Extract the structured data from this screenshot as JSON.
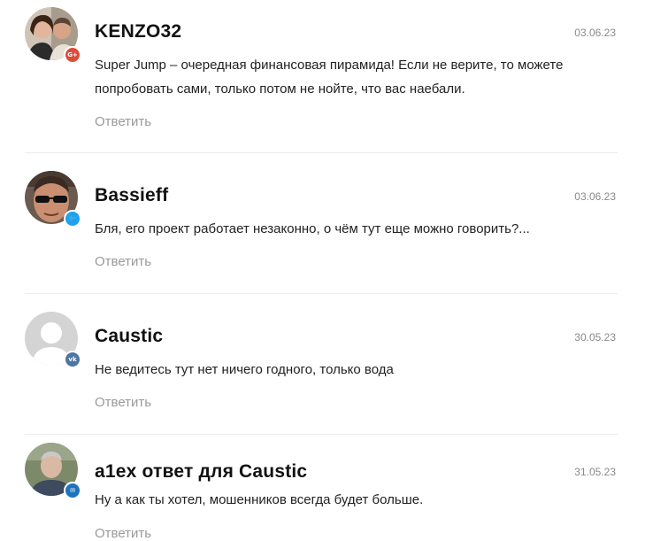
{
  "comments": [
    {
      "author": "KENZO32",
      "date": "03.06.23",
      "text": "Super Jump – очередная финансовая пирамида! Если не верите, то можете попробовать сами, только потом не нойте, что вас наебали.",
      "reply_label": "Ответить",
      "social": "google-plus",
      "badge_label": "G+",
      "badge_color": "#dd4b39"
    },
    {
      "author": "Bassieff",
      "date": "03.06.23",
      "text": "Бля, его проект работает незаконно, о чём тут еще можно говорить?...",
      "reply_label": "Ответить",
      "social": "twitter",
      "badge_label": "🐦",
      "badge_color": "#1da1f2"
    },
    {
      "author": "Caustic",
      "date": "30.05.23",
      "text": "Не ведитесь тут нет ничего годного, только вода",
      "reply_label": "Ответить",
      "social": "vk",
      "badge_label": "vk",
      "badge_color": "#4c75a3"
    },
    {
      "author": "a1ex ответ для Caustic",
      "date": "31.05.23",
      "text": "Ну а как ты хотел, мошенников всегда будет больше.",
      "reply_label": "Ответить",
      "social": "email",
      "badge_label": "✉",
      "badge_color": "#1e73be"
    }
  ]
}
